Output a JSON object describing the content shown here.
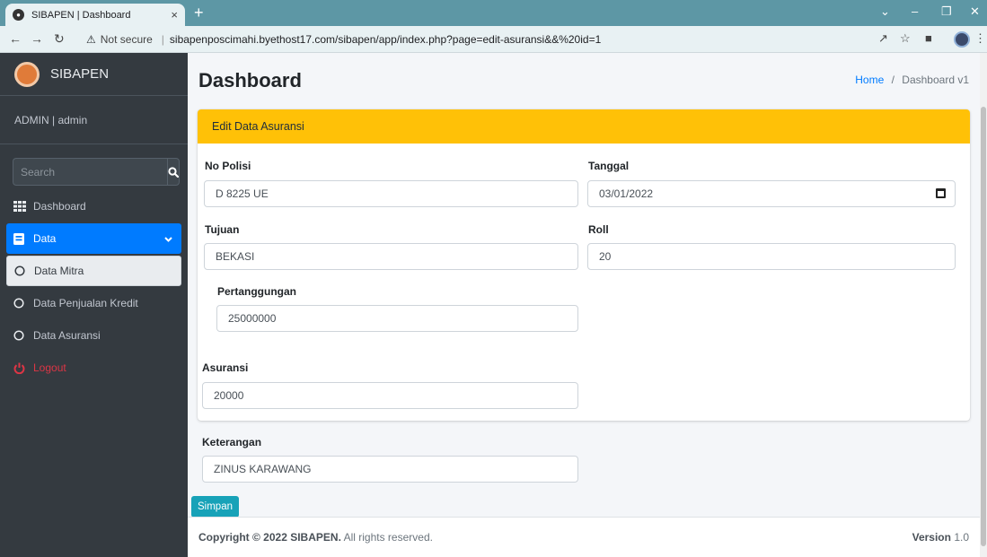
{
  "browser": {
    "tab_title": "SIBAPEN | Dashboard",
    "tab_close": "×",
    "new_tab": "+",
    "not_secure": "Not secure",
    "url": "sibapenposcimahi.byethost17.com/sibapen/app/index.php?page=edit-asuransi&&%20id=1"
  },
  "sidebar": {
    "brand": "SIBAPEN",
    "user": "ADMIN | admin",
    "search_placeholder": "Search",
    "items": [
      {
        "label": "Dashboard",
        "icon": "grid-icon"
      },
      {
        "label": "Data",
        "icon": "book-icon"
      },
      {
        "label": "Data Mitra",
        "icon": "circle-icon"
      },
      {
        "label": "Data Penjualan Kredit",
        "icon": "circle-icon"
      },
      {
        "label": "Data Asuransi",
        "icon": "circle-icon"
      },
      {
        "label": "Logout",
        "icon": "power-icon"
      }
    ]
  },
  "header": {
    "title": "Dashboard",
    "breadcrumb_home": "Home",
    "breadcrumb_sep": "/",
    "breadcrumb_current": "Dashboard v1"
  },
  "form": {
    "card_title": "Edit Data Asuransi",
    "no_polisi_label": "No Polisi",
    "no_polisi_value": "D 8225 UE",
    "tanggal_label": "Tanggal",
    "tanggal_value": "03/01/2022",
    "tujuan_label": "Tujuan",
    "tujuan_value": "BEKASI",
    "roll_label": "Roll",
    "roll_value": "20",
    "pertanggungan_label": "Pertanggungan",
    "pertanggungan_value": "25000000",
    "asuransi_label": "Asuransi",
    "asuransi_value": "20000",
    "keterangan_label": "Keterangan",
    "keterangan_value": "ZINUS KARAWANG",
    "save_label": "Simpan"
  },
  "footer": {
    "copyright_prefix": "Copyright © 2022",
    "brand": "SIBAPEN.",
    "suffix": "All rights reserved.",
    "version_label": "Version",
    "version_value": "1.0"
  },
  "colors": {
    "sidebar_bg": "#343a40",
    "active_blue": "#007bff",
    "card_header": "#ffc107",
    "save_button": "#17a2b8",
    "logout_red": "#dc3545"
  }
}
